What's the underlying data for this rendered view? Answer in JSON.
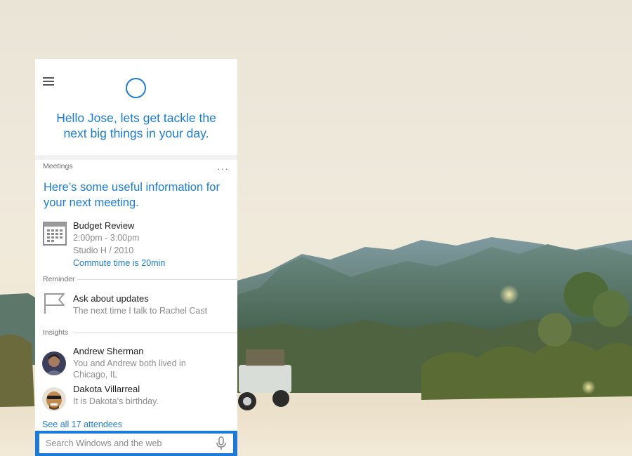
{
  "cortana": {
    "greeting": "Hello Jose, lets get tackle the next big things in your day.",
    "meetings": {
      "label": "Meetings",
      "more": "···",
      "headline": "Here’s some useful information for your next meeting.",
      "item": {
        "title": "Budget Review",
        "time": "2:00pm - 3:00pm",
        "location": "Studio H / 2010",
        "commute_link": "Commute time is 20min"
      }
    },
    "reminder": {
      "label": "Reminder",
      "title": "Ask about updates",
      "detail": "The next time I talk to Rachel Cast"
    },
    "insights": {
      "label": "Insights",
      "people": [
        {
          "name": "Andrew Sherman",
          "detail_line1": "You and Andrew both lived in",
          "detail_line2": "Chicago, IL"
        },
        {
          "name": "Dakota Villarreal",
          "detail_line1": "It is Dakota’s birthday."
        }
      ],
      "see_all": "See all 17 attendees"
    },
    "search": {
      "placeholder": "Search Windows and the web"
    }
  },
  "colors": {
    "accent": "#1a7cd8",
    "panel": "#ffffff",
    "secondary_text": "#8c8c8c"
  },
  "icons": [
    "hamburger-menu-icon",
    "cortana-ring-icon",
    "calendar-icon",
    "flag-icon",
    "microphone-icon"
  ]
}
